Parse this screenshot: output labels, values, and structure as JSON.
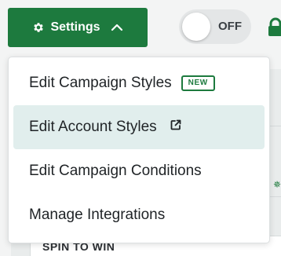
{
  "toolbar": {
    "settings_label": "Settings",
    "settings_icon": "gear-icon",
    "chevron_icon": "chevron-up-icon",
    "toggle_state_label": "OFF",
    "lock_icon": "lock-icon"
  },
  "menu": {
    "items": [
      {
        "label": "Edit Campaign Styles",
        "badge": "NEW"
      },
      {
        "label": "Edit Account Styles",
        "icon": "external-link-icon",
        "highlighted": true
      },
      {
        "label": "Edit Campaign Conditions"
      },
      {
        "label": "Manage Integrations"
      }
    ]
  },
  "background": {
    "card_title": "SPIN TO WIN"
  },
  "colors": {
    "brand_green": "#1d7a3e",
    "menu_highlight": "#e1eeed",
    "toggle_bg": "#e4e6e7"
  }
}
